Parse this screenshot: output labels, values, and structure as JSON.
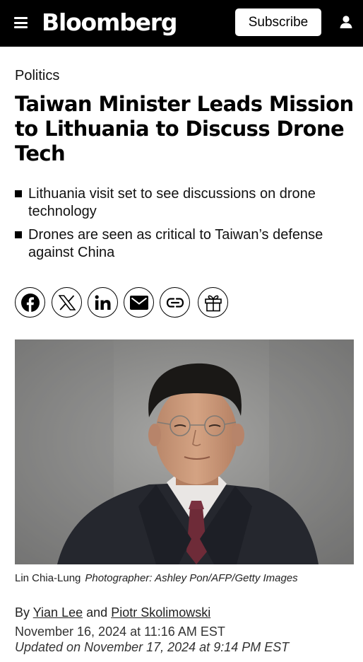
{
  "header": {
    "logo": "Bloomberg",
    "subscribe_label": "Subscribe",
    "menu_icon": "hamburger-menu-icon",
    "user_icon": "user-icon"
  },
  "article": {
    "category": "Politics",
    "headline": "Taiwan Minister Leads Mission to Lithuania to Discuss Drone Tech",
    "bullets": [
      "Lithuania visit set to see discussions on drone technology",
      "Drones are seen as critical to Taiwan’s defense against China"
    ],
    "share_icons": [
      "facebook-icon",
      "x-icon",
      "linkedin-icon",
      "email-icon",
      "link-icon",
      "gift-icon"
    ],
    "photo": {
      "subject": "Lin Chia-Lung",
      "credit": "Photographer: Ashley Pon/AFP/Getty Images"
    },
    "byline": {
      "prefix": "By",
      "author1": "Yian Lee",
      "joiner": "and",
      "author2": "Piotr Skolimowski"
    },
    "published": "November 16, 2024 at 11:16 AM EST",
    "updated": "Updated on November 17, 2024 at 9:14 PM EST"
  },
  "colors": {
    "header_bg": "#000000",
    "text": "#000000",
    "photo_bg": "#8d8d8b"
  }
}
